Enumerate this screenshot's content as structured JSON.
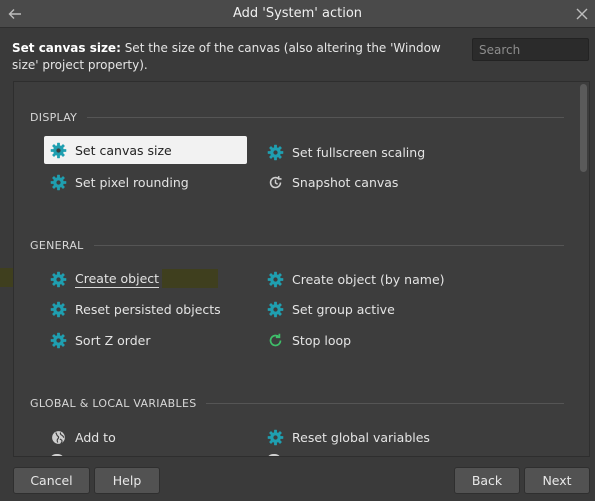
{
  "window": {
    "title": "Add 'System' action"
  },
  "description": {
    "bold": "Set canvas size:",
    "text": " Set the size of the canvas (also altering the 'Window size' project property)."
  },
  "search": {
    "placeholder": "Search",
    "value": ""
  },
  "sections": {
    "display": {
      "label": "DISPLAY",
      "items": [
        {
          "label": "Set canvas size",
          "icon": "gear-icon",
          "selected": true
        },
        {
          "label": "Set fullscreen scaling",
          "icon": "gear-icon"
        },
        {
          "label": "Set pixel rounding",
          "icon": "gear-icon"
        },
        {
          "label": "Snapshot canvas",
          "icon": "snapshot-icon"
        }
      ]
    },
    "general": {
      "label": "GENERAL",
      "items": [
        {
          "label": "Create object",
          "icon": "gear-icon",
          "highlighted": true
        },
        {
          "label": "Create object (by name)",
          "icon": "gear-icon"
        },
        {
          "label": "Reset persisted objects",
          "icon": "gear-icon"
        },
        {
          "label": "Set group active",
          "icon": "gear-icon"
        },
        {
          "label": "Sort Z order",
          "icon": "gear-icon"
        },
        {
          "label": "Stop loop",
          "icon": "loop-icon"
        }
      ]
    },
    "variables": {
      "label": "GLOBAL & LOCAL VARIABLES",
      "items": [
        {
          "label": "Add to",
          "icon": "globe-icon"
        },
        {
          "label": "Reset global variables",
          "icon": "gear-icon"
        }
      ]
    }
  },
  "buttons": {
    "cancel": "Cancel",
    "help": "Help",
    "back": "Back",
    "next": "Next"
  },
  "colors": {
    "gear": "#1f9fb0",
    "loop": "#3fbf6a",
    "highlight": "#3f3f1e",
    "selected_bg": "#f2f2f2"
  }
}
